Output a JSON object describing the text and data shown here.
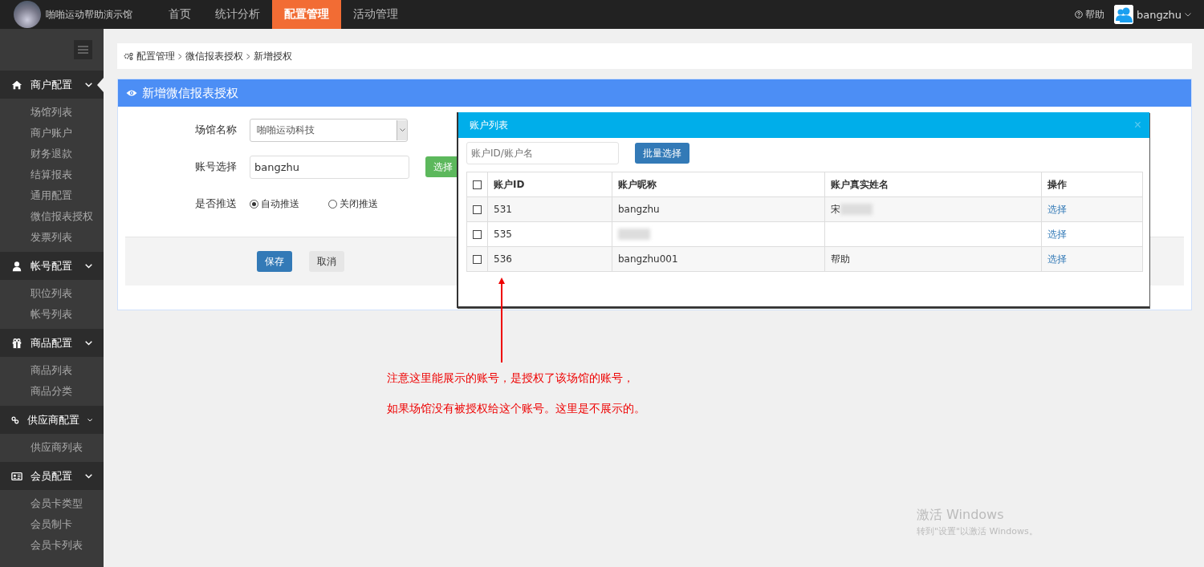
{
  "top_nav": {
    "logo_text": "啪啪运动帮助演示馆",
    "tabs": [
      {
        "label": "首页",
        "selected": false
      },
      {
        "label": "统计分析",
        "selected": false
      },
      {
        "label": "配置管理",
        "selected": true
      },
      {
        "label": "活动管理",
        "selected": false
      }
    ],
    "help": "帮助",
    "user": "bangzhu"
  },
  "sidebar": {
    "groups": [
      {
        "label": "商户配置",
        "selected": true,
        "items": [
          "场馆列表",
          "商户账户",
          "财务退款",
          "结算报表",
          "通用配置",
          "微信报表授权",
          "发票列表"
        ]
      },
      {
        "label": "帐号配置",
        "selected": false,
        "items": [
          "职位列表",
          "帐号列表"
        ]
      },
      {
        "label": "商品配置",
        "selected": false,
        "items": [
          "商品列表",
          "商品分类"
        ]
      },
      {
        "label": "供应商配置",
        "selected": false,
        "items": [
          "供应商列表"
        ]
      },
      {
        "label": "会员配置",
        "selected": false,
        "items": [
          "会员卡类型",
          "会员制卡",
          "会员卡列表"
        ]
      }
    ]
  },
  "breadcrumb": [
    "配置管理",
    "微信报表授权",
    "新增授权"
  ],
  "panel": {
    "title": "新增微信报表授权",
    "venue": {
      "label": "场馆名称",
      "value": "啪啪运动科技"
    },
    "account": {
      "label": "账号选择",
      "value": "bangzhu",
      "button": "选择"
    },
    "push": {
      "label": "是否推送",
      "options": [
        {
          "label": "自动推送",
          "selected": true
        },
        {
          "label": "关闭推送",
          "selected": false
        }
      ]
    },
    "save": "保存",
    "cancel": "取消"
  },
  "modal": {
    "title": "账户列表",
    "close": "×",
    "search_placeholder": "账户ID/账户名",
    "batch_button": "批量选择",
    "select_all_checked": false,
    "columns": [
      "账户ID",
      "账户昵称",
      "账户真实姓名",
      "操作"
    ],
    "rows": [
      {
        "checked": false,
        "id": "531",
        "nickname": "bangzhu",
        "real_name": "宋",
        "real_name_blurred": true,
        "action": "选择"
      },
      {
        "checked": false,
        "id": "535",
        "nickname_blurred": true,
        "action": "选择"
      },
      {
        "checked": false,
        "id": "536",
        "nickname": "bangzhu001",
        "real_name": "帮助",
        "action": "选择"
      }
    ]
  },
  "annotation": [
    "注意这里能展示的账号，是授权了该场馆的账号，",
    "如果场馆没有被授权给这个账号。这里是不展示的。"
  ],
  "os_notice": {
    "title": "激活 Windows",
    "subtitle": "转到\"设置\"以激活 Windows。"
  }
}
